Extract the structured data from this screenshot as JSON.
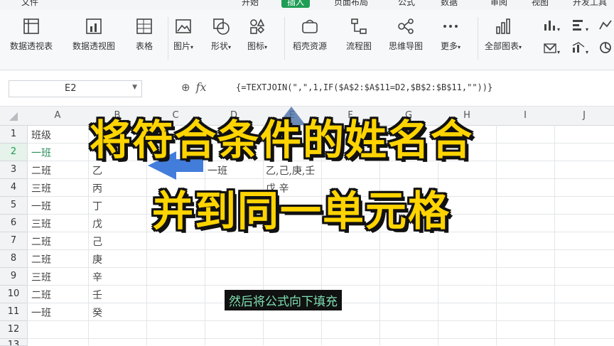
{
  "menu": [
    "文件",
    "开始",
    "插入",
    "页面布局",
    "公式",
    "数据",
    "审阅",
    "视图",
    "开发工具"
  ],
  "ribbon": {
    "buttons": [
      "数据透视表",
      "数据透视图",
      "表格",
      "图片",
      "形状",
      "图标",
      "稻壳资源",
      "流程图",
      "思维导图",
      "更多",
      "全部图表"
    ]
  },
  "formula_bar": {
    "name_box": "E2",
    "fx": "fx",
    "formula": "{=TEXTJOIN(\",\",1,IF($A$2:$A$11=D2,$B$2:$B$11,\"\"))}"
  },
  "columns": [
    "A",
    "B",
    "C",
    "D",
    "E",
    "F",
    "G",
    "H",
    "I",
    "J"
  ],
  "rows": [
    "1",
    "2",
    "3",
    "4",
    "5",
    "6",
    "7",
    "8",
    "9",
    "10",
    "11",
    "12",
    "13"
  ],
  "cells": {
    "header": "班级",
    "col_a": [
      "一班",
      "二班",
      "三班",
      "一班",
      "三班",
      "二班",
      "二班",
      "三班",
      "二班",
      "一班"
    ],
    "col_b": [
      "乙",
      "丙",
      "丁",
      "戊",
      "己",
      "庚",
      "辛",
      "壬",
      "癸"
    ],
    "e_values": [
      "一班",
      "乙,己,庚,壬",
      "戊,辛"
    ]
  },
  "overlay": {
    "line1": "将符合条件的姓名合",
    "line2": "并到同一单元格"
  },
  "subtitle": "然后将公式向下填充",
  "colors": {
    "accent": "#1f9d55",
    "overlay_text": "#ffd400",
    "subtitle_text": "#7ee0b2"
  }
}
